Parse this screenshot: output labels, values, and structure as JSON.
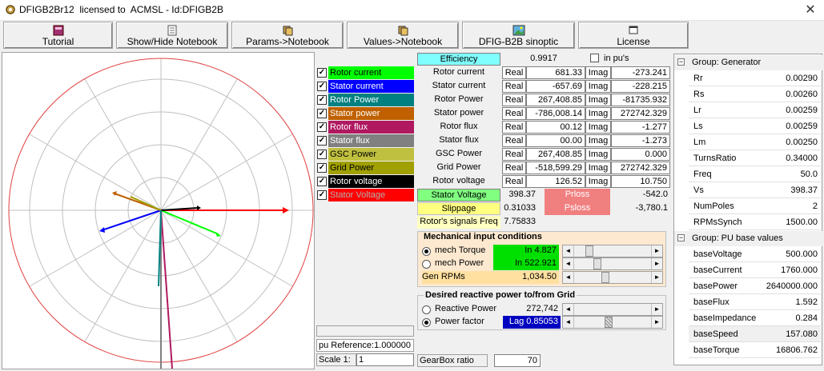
{
  "window": {
    "title": "DFIGB2Br12  licensed to  ACMSL - Id:DFIGB2B",
    "close_glyph": "✕"
  },
  "toolbar": [
    {
      "label": "Tutorial",
      "icon": "book-icon"
    },
    {
      "label": "Show/Hide Notebook",
      "icon": "notebook-icon"
    },
    {
      "label": "Params->Notebook",
      "icon": "copy-icon"
    },
    {
      "label": "Values->Notebook",
      "icon": "copy-icon"
    },
    {
      "label": "DFIG-B2B sinoptic",
      "icon": "image-icon"
    },
    {
      "label": "License",
      "icon": "window-icon"
    }
  ],
  "legend": [
    {
      "label": "Rotor current",
      "color": "#00ff00",
      "text": "#000000"
    },
    {
      "label": "Stator current",
      "color": "#0000ff",
      "text": "#ffffff"
    },
    {
      "label": "Rotor Power",
      "color": "#008080",
      "text": "#ffffff"
    },
    {
      "label": "Stator power",
      "color": "#c06000",
      "text": "#ffffff"
    },
    {
      "label": "Rotor flux",
      "color": "#b01860",
      "text": "#ffffff"
    },
    {
      "label": "Stator flux",
      "color": "#808080",
      "text": "#ffffff"
    },
    {
      "label": "GSC Power",
      "color": "#c0c040",
      "text": "#000000"
    },
    {
      "label": "Grid Power",
      "color": "#a0a000",
      "text": "#000000"
    },
    {
      "label": "Rotor voltage",
      "color": "#000000",
      "text": "#ffffff"
    },
    {
      "label": "Stator Voltage",
      "color": "#ff0000",
      "text": "#b0b0b0"
    }
  ],
  "legend_check": "✓",
  "pu_reference": "pu Reference:1.000000",
  "scale": {
    "label": "Scale 1:",
    "value": "1"
  },
  "efficiency": {
    "label": "Efficiency",
    "value": "0.9917",
    "pu_label": "in pu's"
  },
  "measurements": [
    {
      "label": "Rotor current",
      "real": "681.33",
      "imag": "-273.241"
    },
    {
      "label": "Stator current",
      "real": "-657.69",
      "imag": "-228.215"
    },
    {
      "label": "Rotor Power",
      "real": "267,408.85",
      "imag": "-81735.932"
    },
    {
      "label": "Stator power",
      "real": "-786,008.14",
      "imag": "272742.329"
    },
    {
      "label": "Rotor flux",
      "real": "00.12",
      "imag": "-1.277"
    },
    {
      "label": "Stator flux",
      "real": "00.00",
      "imag": "-1.273"
    },
    {
      "label": "GSC Power",
      "real": "267,408.85",
      "imag": "0.000"
    },
    {
      "label": "Grid Power",
      "real": "-518,599.29",
      "imag": "272742.329"
    },
    {
      "label": "Rotor voltage",
      "real": "126.52",
      "imag": "10.750"
    }
  ],
  "real_tag": "Real",
  "imag_tag": "Imag",
  "stator_voltage": {
    "label": "Stator Voltage",
    "value": "398.37"
  },
  "slippage": {
    "label": "Slippage",
    "value": "0.31033"
  },
  "rotor_freq": {
    "label": "Rotor's signals Freq",
    "value": "7.75833"
  },
  "prloss": {
    "label": "Prloss",
    "value": "-542.0"
  },
  "psloss": {
    "label": "Psloss",
    "value": "-3,780.1"
  },
  "mech": {
    "title": "Mechanical input conditions",
    "torque_label": "mech Torque",
    "torque_value": "In 4.827",
    "power_label": "mech Power",
    "power_value": "In 522.921",
    "rpm_label": "Gen RPMs",
    "rpm_value": "1,034.50"
  },
  "reactive": {
    "title": "Desired reactive power to/from Grid",
    "rp_label": "Reactive Power",
    "rp_value": "272,742",
    "pf_label": "Power factor",
    "pf_value": "Lag  0.85053"
  },
  "gearbox": {
    "label": "GearBox ratio",
    "value": "70"
  },
  "props": {
    "group1": "Group: Generator",
    "group1_rows": [
      {
        "k": "Rr",
        "v": "0.00290"
      },
      {
        "k": "Rs",
        "v": "0.00260"
      },
      {
        "k": "Lr",
        "v": "0.00259"
      },
      {
        "k": "Ls",
        "v": "0.00259"
      },
      {
        "k": "Lm",
        "v": "0.00250"
      },
      {
        "k": "TurnsRatio",
        "v": "0.34000"
      },
      {
        "k": "Freq",
        "v": "50.0"
      },
      {
        "k": "Vs",
        "v": "398.37"
      },
      {
        "k": "NumPoles",
        "v": "2"
      },
      {
        "k": "RPMsSynch",
        "v": "1500.00"
      }
    ],
    "group2": "Group: PU base values",
    "group2_rows": [
      {
        "k": "baseVoltage",
        "v": "500.000"
      },
      {
        "k": "baseCurrent",
        "v": "1760.000"
      },
      {
        "k": "basePower",
        "v": "2640000.000"
      },
      {
        "k": "baseFlux",
        "v": "1.592"
      },
      {
        "k": "baseImpedance",
        "v": "0.284"
      },
      {
        "k": "baseSpeed",
        "v": "157.080"
      },
      {
        "k": "baseTorque",
        "v": "16806.762"
      }
    ],
    "collapse_glyph": "−"
  },
  "scroll_left": "◄",
  "scroll_right": "►"
}
